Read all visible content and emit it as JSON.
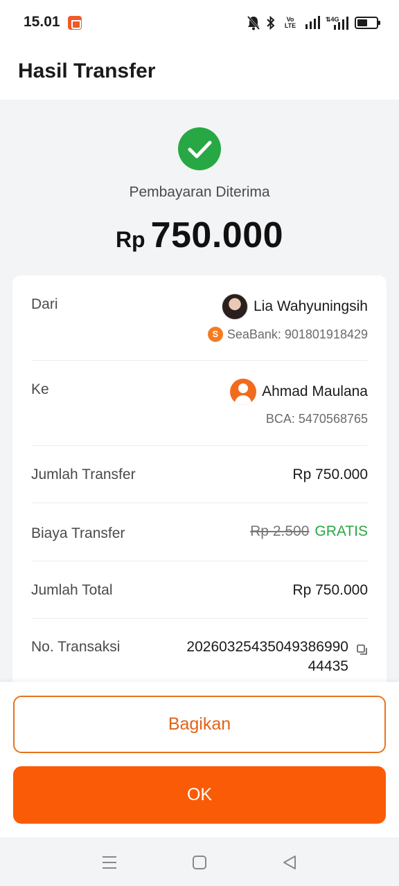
{
  "status_bar": {
    "time": "15.01",
    "icons": [
      "shopee-notification-icon",
      "mute-icon",
      "bluetooth-icon",
      "volte-icon",
      "signal-icon",
      "4g-signal-icon",
      "battery-icon"
    ],
    "volte_text": "Vo LTE"
  },
  "header": {
    "title": "Hasil Transfer"
  },
  "result": {
    "status_text": "Pembayaran Diterima",
    "currency": "Rp",
    "amount": "750.000",
    "success_color": "#27a844"
  },
  "details": {
    "from": {
      "label": "Dari",
      "name": "Lia Wahyuningsih",
      "bank_account": "SeaBank: 901801918429",
      "bank_logo_letter": "S"
    },
    "to": {
      "label": "Ke",
      "name": "Ahmad Maulana",
      "bank_account": "BCA: 5470568765"
    },
    "transfer_amount": {
      "label": "Jumlah Transfer",
      "value": "Rp 750.000"
    },
    "transfer_fee": {
      "label": "Biaya Transfer",
      "original": "Rp 2.500",
      "value": "GRATIS"
    },
    "total_amount": {
      "label": "Jumlah Total",
      "value": "Rp 750.000"
    },
    "transaction_no": {
      "label": "No. Transaksi",
      "line1": "20260325435049386990",
      "line2": "44435"
    }
  },
  "actions": {
    "share_label": "Bagikan",
    "ok_label": "OK",
    "accent_color": "#fa5b07"
  },
  "nav": {
    "icons": [
      "menu-icon",
      "home-icon",
      "back-icon"
    ]
  }
}
